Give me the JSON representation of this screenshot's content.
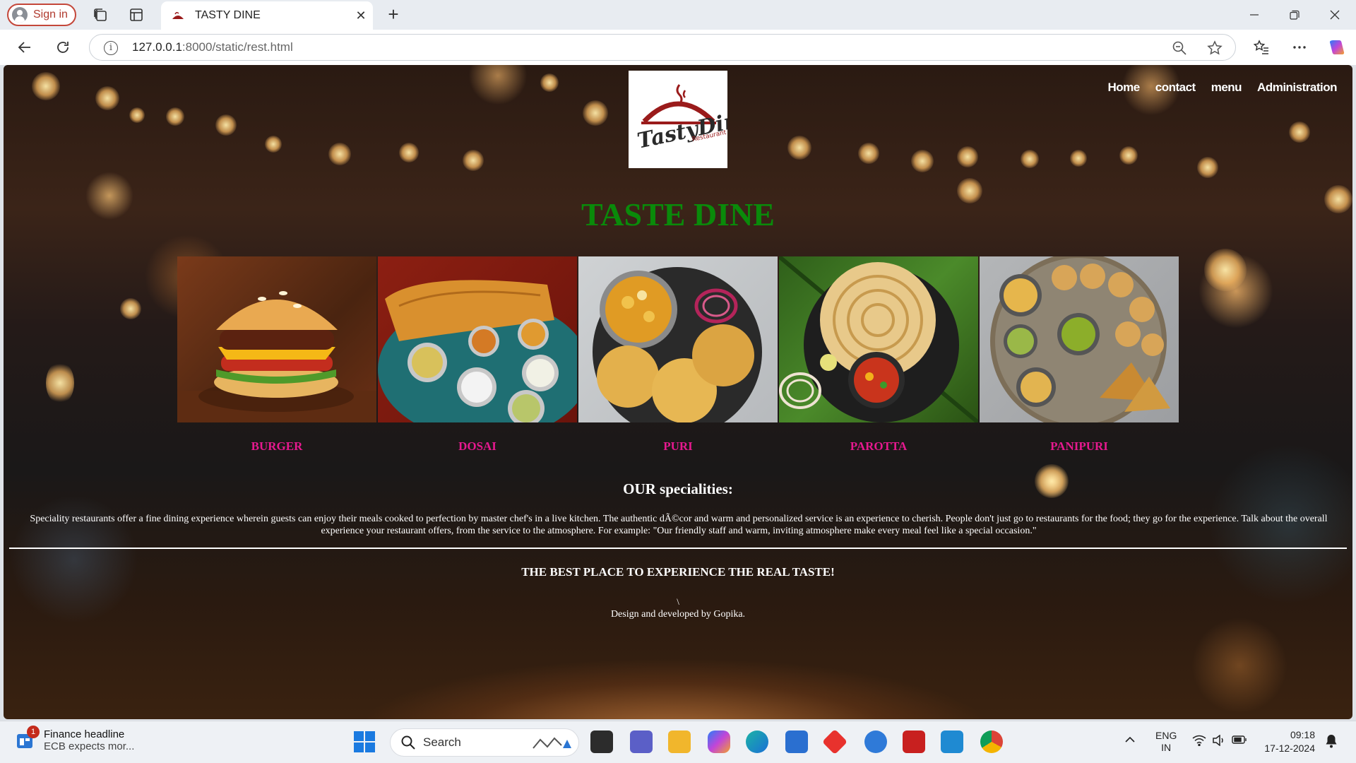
{
  "browser": {
    "signin_label": "Sign in",
    "tab_title": "TASTY DINE",
    "url_host": "127.0.0.1",
    "url_rest": ":8000/static/rest.html"
  },
  "site": {
    "logo_text": "TastyDine",
    "logo_subtext": "Restaurant",
    "nav": [
      "Home",
      "contact",
      "menu",
      "Administration"
    ],
    "title": "TASTE DINE",
    "dishes": [
      "BURGER",
      "DOSAI",
      "PURI",
      "PAROTTA",
      "PANIPURI"
    ],
    "specialities_heading": "OUR specialities:",
    "specialities_text": "Speciality restaurants offer a fine dining experience wherein guests can enjoy their meals cooked to perfection by master chef's in a live kitchen. The authentic dÃ©cor and warm and personalized service is an experience to cherish. People don't just go to restaurants for the food; they go for the experience. Talk about the overall experience your restaurant offers, from the service to the atmosphere. For example: \"Our friendly staff and warm, inviting atmosphere make every meal feel like a special occasion.\"",
    "tagline": "THE BEST PLACE TO EXPERIENCE THE REAL TASTE!",
    "backslash": "\\",
    "credit": "Design and developed by Gopika."
  },
  "taskbar": {
    "news_badge": "1",
    "news_title": "Finance headline",
    "news_sub": "ECB expects mor...",
    "search_label": "Search",
    "lang_top": "ENG",
    "lang_bottom": "IN",
    "time": "09:18",
    "date": "17-12-2024"
  },
  "colors": {
    "title_green": "#0a8a0a",
    "dish_pink": "#e6198f",
    "logo_red": "#9a1b1b"
  }
}
